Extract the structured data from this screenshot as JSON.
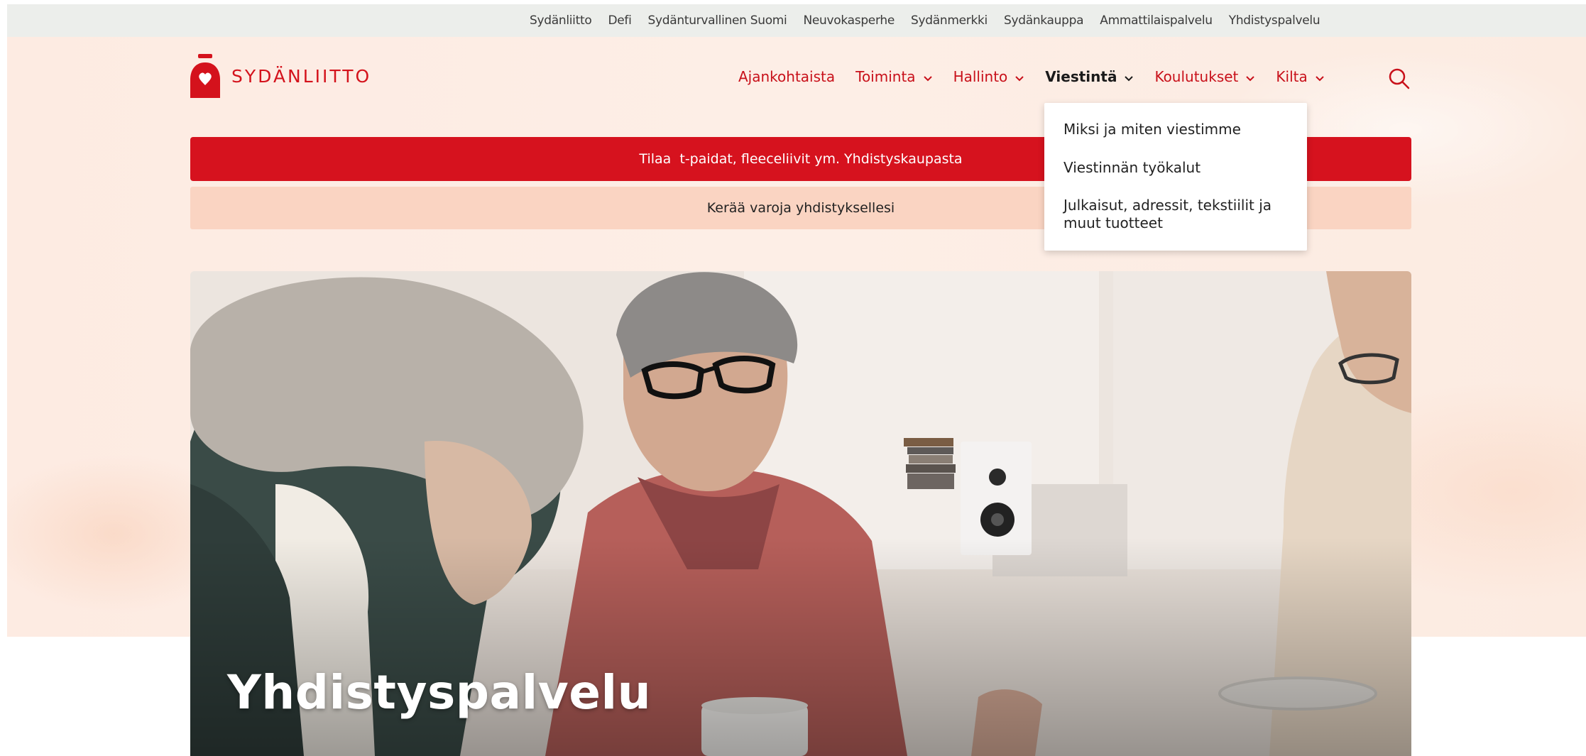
{
  "top_links": [
    "Sydänliitto",
    "Defi",
    "Sydänturvallinen Suomi",
    "Neuvokasperhe",
    "Sydänmerkki",
    "Sydänkauppa",
    "Ammattilaispalvelu",
    "Yhdistyspalvelu"
  ],
  "logo": {
    "text": "SYDÄNLIITTO"
  },
  "nav": {
    "items": [
      {
        "label": "Ajankohtaista"
      },
      {
        "label": "Toiminta"
      },
      {
        "label": "Hallinto"
      },
      {
        "label": "Viestintä"
      },
      {
        "label": "Koulutukset"
      },
      {
        "label": "Kilta"
      }
    ],
    "search_icon": "search-icon"
  },
  "banners": {
    "primary": "Tilaa  t-paidat, fleeceliivit ym. Yhdistyskaupasta",
    "secondary": "Kerää varoja yhdistyksellesi"
  },
  "dropdown": {
    "items": [
      "Miksi ja miten viestimme",
      "Viestinnän työkalut",
      "Julkaisut, adressit, tekstiilit ja muut tuotteet"
    ]
  },
  "hero": {
    "title": "Yhdistyspalvelu"
  },
  "colors": {
    "brand_red": "#d4121c",
    "banner_peach": "#fad4c2",
    "topbar_gray": "#eceeeb"
  }
}
